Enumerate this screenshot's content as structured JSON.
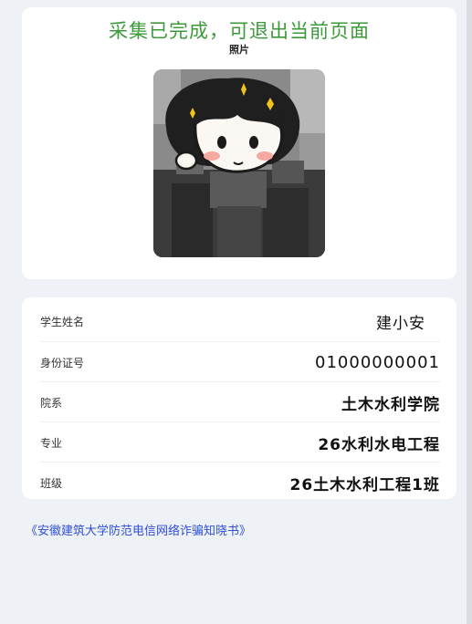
{
  "header": {
    "status_message": "采集已完成，可退出当前页面",
    "photo_label": "照片"
  },
  "student_info": {
    "rows": [
      {
        "label": "学生姓名",
        "value": "建小安"
      },
      {
        "label": "身份证号",
        "value": "01000000001"
      },
      {
        "label": "院系",
        "value": "土木水利学院"
      },
      {
        "label": "专业",
        "value": "26水利水电工程"
      },
      {
        "label": "班级",
        "value": "26土木水利工程1班"
      }
    ]
  },
  "footer": {
    "notice_link": "《安徽建筑大学防范电信网络诈骗知晓书》"
  },
  "colors": {
    "status_green": "#3d9a3a",
    "link_blue": "#2f4fd6",
    "background": "#eef1f5"
  }
}
